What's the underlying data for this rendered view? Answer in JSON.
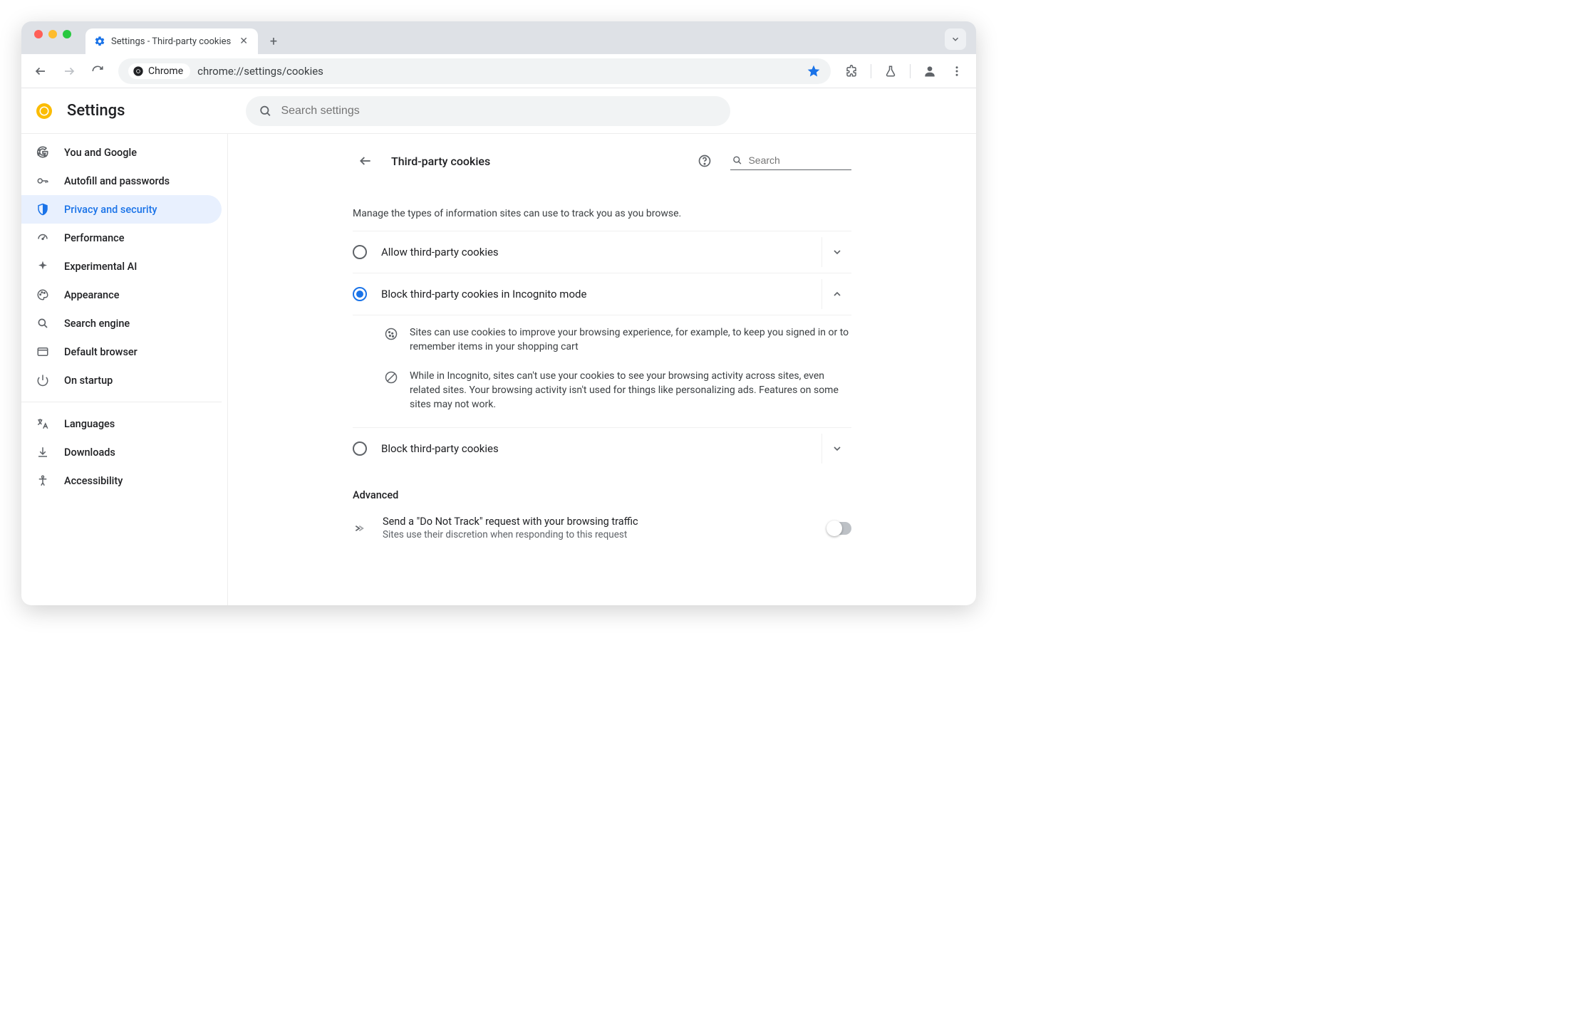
{
  "tab": {
    "title": "Settings - Third-party cookies"
  },
  "omnibox": {
    "chip_label": "Chrome",
    "url": "chrome://settings/cookies"
  },
  "app_header": {
    "title": "Settings",
    "search_placeholder": "Search settings"
  },
  "sidebar": {
    "items": [
      {
        "label": "You and Google"
      },
      {
        "label": "Autofill and passwords"
      },
      {
        "label": "Privacy and security"
      },
      {
        "label": "Performance"
      },
      {
        "label": "Experimental AI"
      },
      {
        "label": "Appearance"
      },
      {
        "label": "Search engine"
      },
      {
        "label": "Default browser"
      },
      {
        "label": "On startup"
      }
    ],
    "items2": [
      {
        "label": "Languages"
      },
      {
        "label": "Downloads"
      },
      {
        "label": "Accessibility"
      }
    ]
  },
  "content": {
    "title": "Third-party cookies",
    "search_placeholder": "Search",
    "description": "Manage the types of information sites can use to track you as you browse.",
    "options": [
      {
        "label": "Allow third-party cookies"
      },
      {
        "label": "Block third-party cookies in Incognito mode"
      },
      {
        "label": "Block third-party cookies"
      }
    ],
    "details": [
      "Sites can use cookies to improve your browsing experience, for example, to keep you signed in or to remember items in your shopping cart",
      "While in Incognito, sites can't use your cookies to see your browsing activity across sites, even related sites. Your browsing activity isn't used for things like personalizing ads. Features on some sites may not work."
    ],
    "advanced_label": "Advanced",
    "dnt": {
      "title": "Send a \"Do Not Track\" request with your browsing traffic",
      "sub": "Sites use their discretion when responding to this request"
    }
  }
}
